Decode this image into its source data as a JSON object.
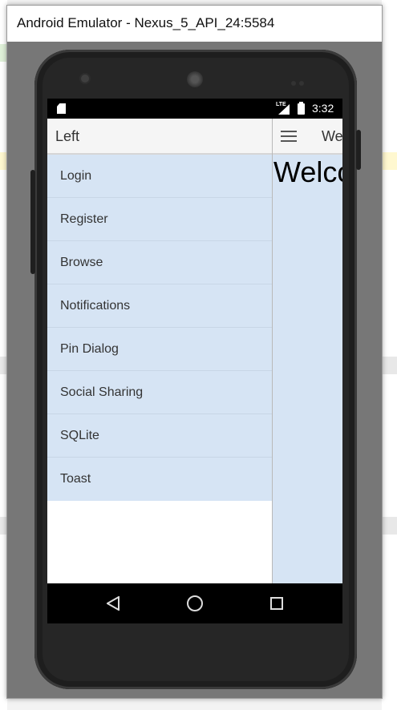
{
  "window": {
    "title": "Android Emulator - Nexus_5_API_24:5584"
  },
  "status_bar": {
    "network": "LTE",
    "time": "3:32"
  },
  "drawer": {
    "title": "Left",
    "items": [
      {
        "label": "Login"
      },
      {
        "label": "Register"
      },
      {
        "label": "Browse"
      },
      {
        "label": "Notifications"
      },
      {
        "label": "Pin Dialog"
      },
      {
        "label": "Social Sharing"
      },
      {
        "label": "SQLite"
      },
      {
        "label": "Toast"
      }
    ]
  },
  "detail": {
    "bar_title": "We",
    "heading": "Welco"
  },
  "colors": {
    "menu_background": "#d6e4f4",
    "header_background": "#f5f5f5",
    "phone_body": "#262626"
  },
  "icons": [
    "sd-card-icon",
    "signal-icon",
    "battery-icon",
    "hamburger-icon",
    "back-icon",
    "home-icon",
    "recents-icon"
  ]
}
